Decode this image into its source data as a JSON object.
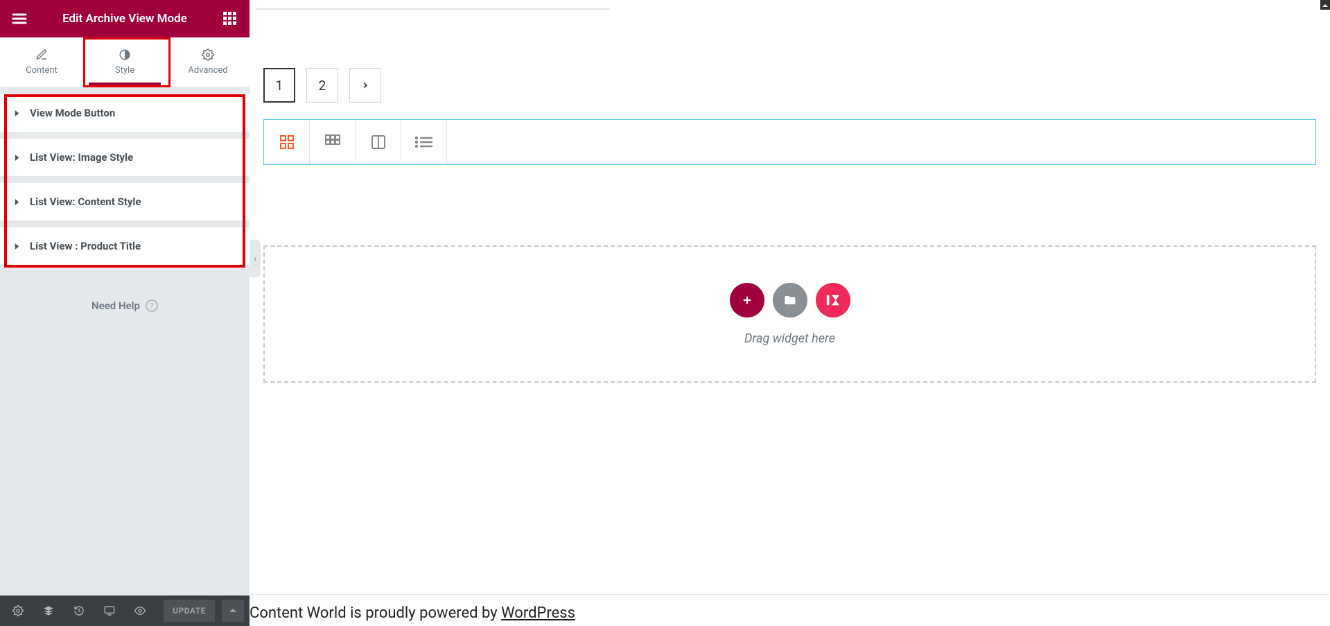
{
  "header": {
    "title": "Edit Archive View Mode"
  },
  "tabs": {
    "content": "Content",
    "style": "Style",
    "advanced": "Advanced"
  },
  "accordion": {
    "items": [
      "View Mode Button",
      "List View: Image Style",
      "List View: Content Style",
      "List View : Product Title"
    ]
  },
  "help": {
    "label": "Need Help"
  },
  "footer": {
    "update": "UPDATE"
  },
  "pagination": {
    "page1": "1",
    "page2": "2"
  },
  "dropzone": {
    "text": "Drag widget here"
  },
  "pageFooter": {
    "prefix": "Content World is proudly powered by ",
    "link": "WordPress"
  }
}
